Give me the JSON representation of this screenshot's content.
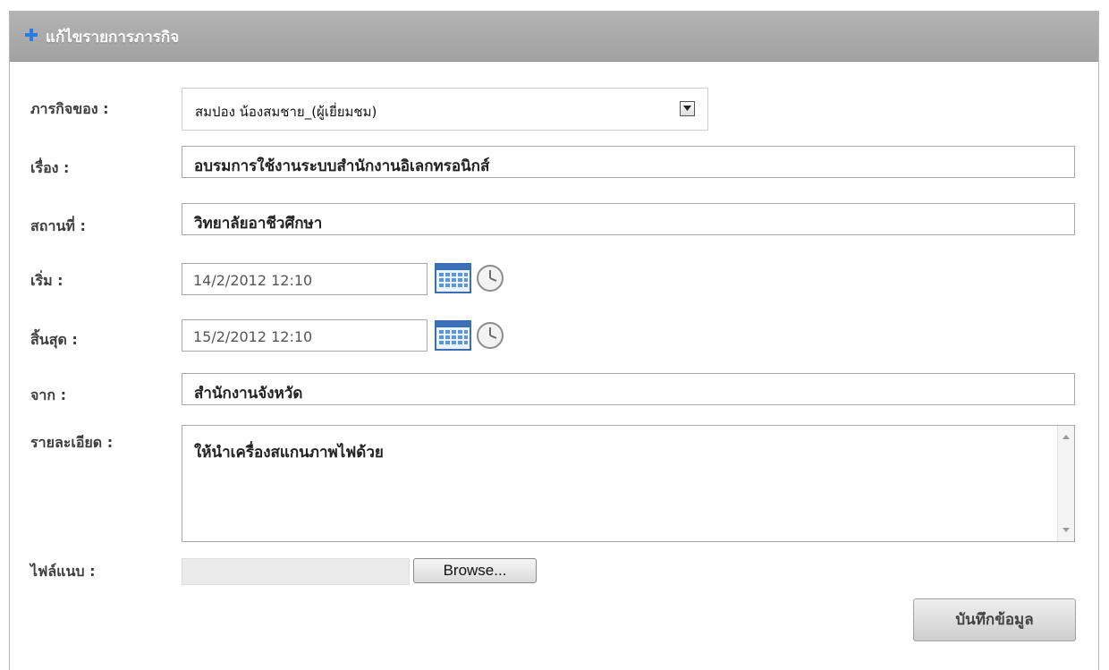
{
  "panel": {
    "title": "แก้ไขรายการภารกิจ",
    "header_icon": "plus-icon",
    "accent_color": "#2a7be4"
  },
  "form": {
    "owner": {
      "label": "ภารกิจของ :",
      "value": "สมปอง น้องสมชาย_(ผู้เยี่ยมชม)"
    },
    "subject": {
      "label": "เรื่อง :",
      "value": "อบรมการใช้งานระบบสำนักงานอิเลกทรอนิกส์"
    },
    "location": {
      "label": "สถานที่ :",
      "value": "วิทยาลัยอาชีวศึกษา"
    },
    "start": {
      "label": "เริ่ม :",
      "value": "14/2/2012 12:10"
    },
    "end": {
      "label": "สิ้นสุด :",
      "value": "15/2/2012 12:10"
    },
    "from": {
      "label": "จาก :",
      "value": "สำนักงานจังหวัด"
    },
    "details": {
      "label": "รายละเอียด :",
      "value": "ให้นำเครื่องสแกนภาพไฟด้วย"
    },
    "attachment": {
      "label": "ไฟล์แนบ :",
      "browse_label": "Browse..."
    }
  },
  "actions": {
    "save_label": "บันทึกข้อมูล"
  }
}
